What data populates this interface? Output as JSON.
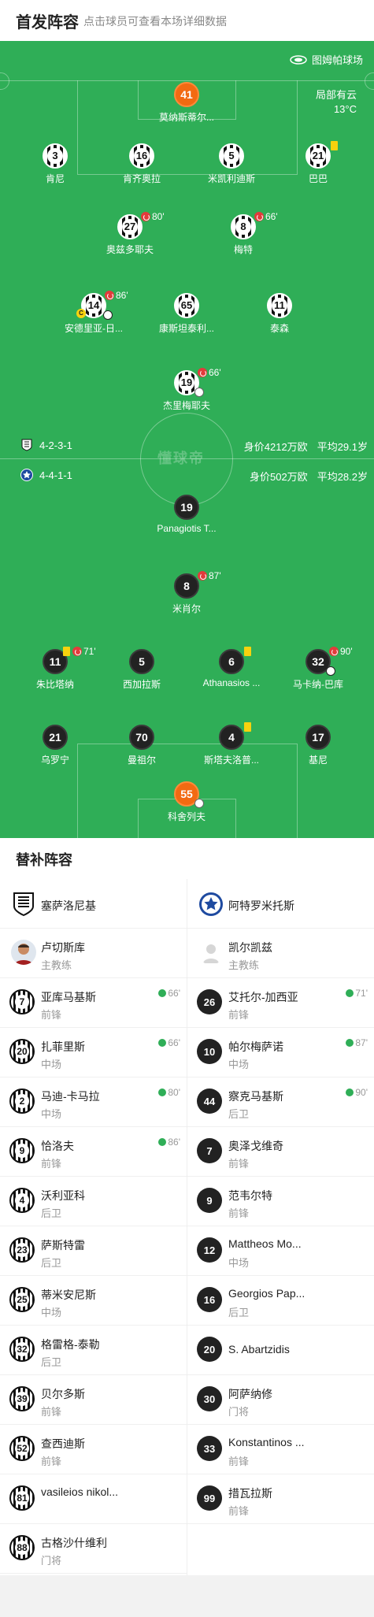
{
  "header": {
    "title": "首发阵容",
    "hint": "点击球员可查看本场详细数据"
  },
  "pitch": {
    "stadium": "图姆帕球场",
    "weather": "局部有云",
    "temperature": "13°C",
    "watermark": "懂球帝",
    "home_team": {
      "formation": "4-2-3-1",
      "value": "身价4212万欧",
      "age": "平均29.1岁"
    },
    "away_team": {
      "formation": "4-4-1-1",
      "value": "身价502万欧",
      "age": "平均28.2岁"
    },
    "home_players": [
      {
        "num": "41",
        "name": "莫纳斯蒂尔...",
        "kit": "gk"
      },
      {
        "num": "3",
        "name": "肯尼",
        "kit": "stripe"
      },
      {
        "num": "16",
        "name": "肯齐奥拉",
        "kit": "stripe"
      },
      {
        "num": "5",
        "name": "米凯利迪斯",
        "kit": "stripe"
      },
      {
        "num": "21",
        "name": "巴巴",
        "kit": "stripe"
      },
      {
        "num": "27",
        "name": "奥兹多耶夫",
        "kit": "stripe",
        "sub": "80'"
      },
      {
        "num": "8",
        "name": "梅特",
        "kit": "stripe",
        "sub": "66'"
      },
      {
        "num": "14",
        "name": "安德里亚-日...",
        "kit": "stripe",
        "sub": "86'"
      },
      {
        "num": "65",
        "name": "康斯坦泰利...",
        "kit": "stripe"
      },
      {
        "num": "11",
        "name": "泰森",
        "kit": "stripe"
      },
      {
        "num": "19",
        "name": "杰里梅耶夫",
        "kit": "stripe",
        "sub": "66'"
      }
    ],
    "away_players": [
      {
        "num": "19",
        "name": "Panagiotis T...",
        "kit": "dark"
      },
      {
        "num": "8",
        "name": "米肖尔",
        "kit": "dark",
        "sub": "87'"
      },
      {
        "num": "11",
        "name": "朱比塔纳",
        "kit": "dark",
        "sub": "71'"
      },
      {
        "num": "5",
        "name": "西加拉斯",
        "kit": "dark"
      },
      {
        "num": "6",
        "name": "Athanasios ...",
        "kit": "dark"
      },
      {
        "num": "32",
        "name": "马卡纳-巴库",
        "kit": "dark",
        "sub": "90'"
      },
      {
        "num": "21",
        "name": "乌罗宁",
        "kit": "dark"
      },
      {
        "num": "70",
        "name": "曼祖尔",
        "kit": "dark"
      },
      {
        "num": "4",
        "name": "斯塔夫洛普...",
        "kit": "dark"
      },
      {
        "num": "17",
        "name": "基尼",
        "kit": "dark"
      },
      {
        "num": "55",
        "name": "科舍列夫",
        "kit": "gk"
      }
    ]
  },
  "subs": {
    "title": "替补阵容",
    "home": {
      "team": "塞萨洛尼基",
      "coach": {
        "name": "卢切斯库",
        "role": "主教练"
      },
      "players": [
        {
          "num": "7",
          "name": "亚库马基斯",
          "pos": "前锋",
          "in": "66'"
        },
        {
          "num": "20",
          "name": "扎菲里斯",
          "pos": "中场",
          "in": "66'"
        },
        {
          "num": "2",
          "name": "马迪-卡马拉",
          "pos": "中场",
          "in": "80'"
        },
        {
          "num": "9",
          "name": "恰洛夫",
          "pos": "前锋",
          "in": "86'"
        },
        {
          "num": "4",
          "name": "沃利亚科",
          "pos": "后卫"
        },
        {
          "num": "23",
          "name": "萨斯特雷",
          "pos": "后卫"
        },
        {
          "num": "25",
          "name": "蒂米安尼斯",
          "pos": "中场"
        },
        {
          "num": "32",
          "name": "格雷格-泰勒",
          "pos": "后卫"
        },
        {
          "num": "39",
          "name": "贝尔多斯",
          "pos": "前锋"
        },
        {
          "num": "52",
          "name": "查西迪斯",
          "pos": "前锋"
        },
        {
          "num": "81",
          "name": "vasileios nikol...",
          "pos": ""
        },
        {
          "num": "88",
          "name": "古格沙什维利",
          "pos": "门将"
        }
      ]
    },
    "away": {
      "team": "阿特罗米托斯",
      "coach": {
        "name": "凯尔凯兹",
        "role": "主教练"
      },
      "players": [
        {
          "num": "26",
          "name": "艾托尔-加西亚",
          "pos": "前锋",
          "in": "71'"
        },
        {
          "num": "10",
          "name": "帕尔梅萨诺",
          "pos": "中场",
          "in": "87'"
        },
        {
          "num": "44",
          "name": "察克马基斯",
          "pos": "后卫",
          "in": "90'"
        },
        {
          "num": "7",
          "name": "奥泽戈维奇",
          "pos": "前锋"
        },
        {
          "num": "9",
          "name": "范韦尔特",
          "pos": "前锋"
        },
        {
          "num": "12",
          "name": "Mattheos Mo...",
          "pos": "中场"
        },
        {
          "num": "16",
          "name": "Georgios Pap...",
          "pos": "后卫"
        },
        {
          "num": "20",
          "name": "S. Abartzidis",
          "pos": ""
        },
        {
          "num": "30",
          "name": "阿萨纳修",
          "pos": "门将"
        },
        {
          "num": "33",
          "name": "Konstantinos ...",
          "pos": "前锋"
        },
        {
          "num": "99",
          "name": "措瓦拉斯",
          "pos": "前锋"
        }
      ]
    }
  }
}
